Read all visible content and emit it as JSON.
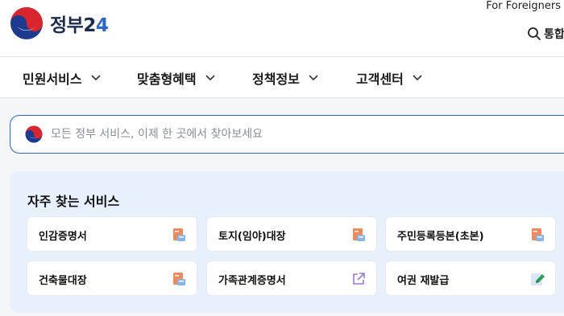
{
  "header": {
    "logo_text_prefix": "정부",
    "logo_text_num1": "2",
    "logo_text_num2": "4",
    "foreigners_link": "For Foreigners",
    "search_link": "통합"
  },
  "gnb": {
    "items": [
      {
        "label": "민원서비스"
      },
      {
        "label": "맞춤형혜택"
      },
      {
        "label": "정책정보"
      },
      {
        "label": "고객센터"
      }
    ]
  },
  "search": {
    "placeholder": "모든 정부 서비스, 이제 한 곳에서 찾아보세요"
  },
  "quick": {
    "title": "자주 찾는 서비스",
    "services": [
      {
        "label": "인감증명서",
        "icon": "document-print-icon"
      },
      {
        "label": "토지(임야)대장",
        "icon": "document-print-icon"
      },
      {
        "label": "주민등록등본(초본)",
        "icon": "document-print-icon"
      },
      {
        "label": "건축물대장",
        "icon": "document-print-icon"
      },
      {
        "label": "가족관계증명서",
        "icon": "external-link-icon"
      },
      {
        "label": "여권 재발급",
        "icon": "edit-pencil-icon"
      }
    ]
  },
  "colors": {
    "accent": "#2f64c8",
    "panel": "#e8f1fb",
    "doc_icon": "#f08a5d"
  }
}
